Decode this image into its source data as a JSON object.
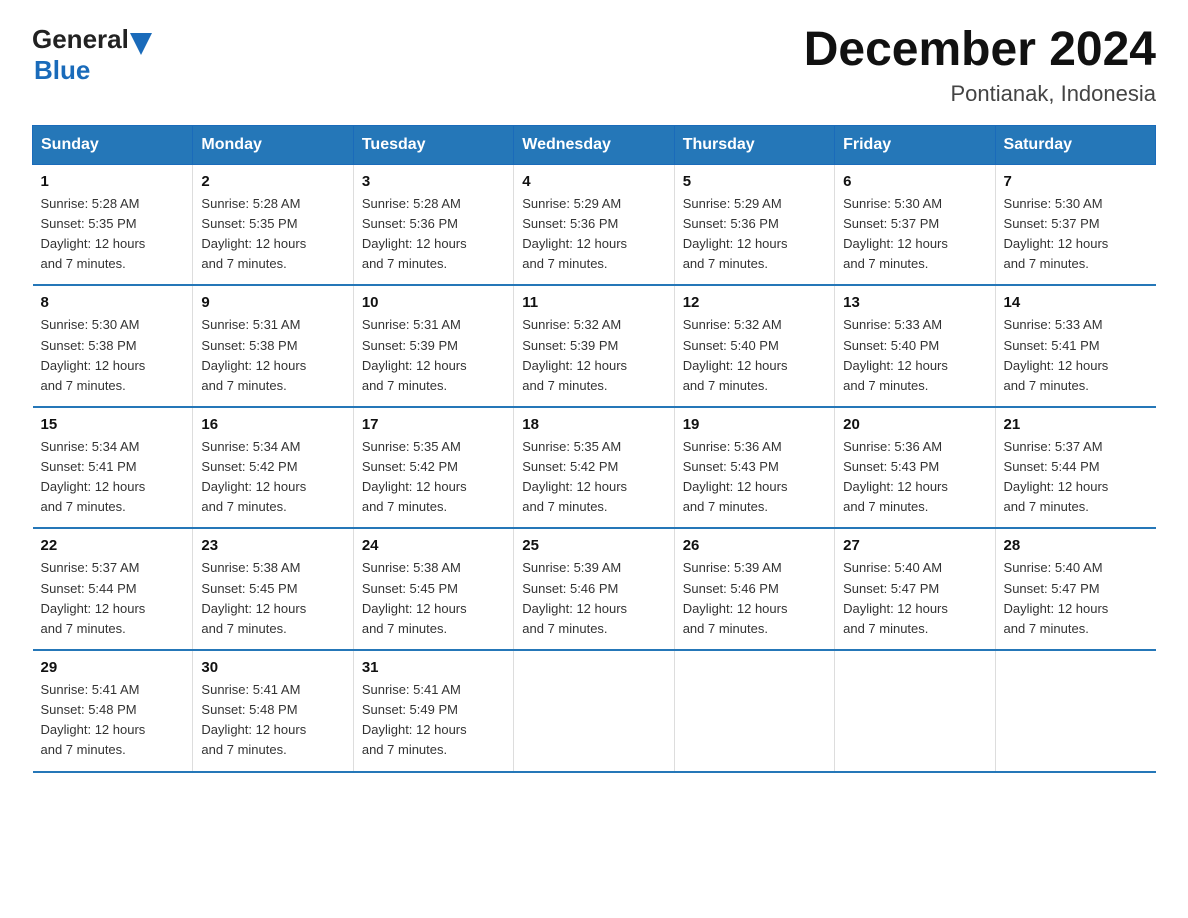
{
  "header": {
    "logo_general": "General",
    "logo_blue": "Blue",
    "month_title": "December 2024",
    "location": "Pontianak, Indonesia"
  },
  "columns": [
    "Sunday",
    "Monday",
    "Tuesday",
    "Wednesday",
    "Thursday",
    "Friday",
    "Saturday"
  ],
  "weeks": [
    [
      {
        "day": "1",
        "sunrise": "5:28 AM",
        "sunset": "5:35 PM",
        "daylight": "12 hours and 7 minutes."
      },
      {
        "day": "2",
        "sunrise": "5:28 AM",
        "sunset": "5:35 PM",
        "daylight": "12 hours and 7 minutes."
      },
      {
        "day": "3",
        "sunrise": "5:28 AM",
        "sunset": "5:36 PM",
        "daylight": "12 hours and 7 minutes."
      },
      {
        "day": "4",
        "sunrise": "5:29 AM",
        "sunset": "5:36 PM",
        "daylight": "12 hours and 7 minutes."
      },
      {
        "day": "5",
        "sunrise": "5:29 AM",
        "sunset": "5:36 PM",
        "daylight": "12 hours and 7 minutes."
      },
      {
        "day": "6",
        "sunrise": "5:30 AM",
        "sunset": "5:37 PM",
        "daylight": "12 hours and 7 minutes."
      },
      {
        "day": "7",
        "sunrise": "5:30 AM",
        "sunset": "5:37 PM",
        "daylight": "12 hours and 7 minutes."
      }
    ],
    [
      {
        "day": "8",
        "sunrise": "5:30 AM",
        "sunset": "5:38 PM",
        "daylight": "12 hours and 7 minutes."
      },
      {
        "day": "9",
        "sunrise": "5:31 AM",
        "sunset": "5:38 PM",
        "daylight": "12 hours and 7 minutes."
      },
      {
        "day": "10",
        "sunrise": "5:31 AM",
        "sunset": "5:39 PM",
        "daylight": "12 hours and 7 minutes."
      },
      {
        "day": "11",
        "sunrise": "5:32 AM",
        "sunset": "5:39 PM",
        "daylight": "12 hours and 7 minutes."
      },
      {
        "day": "12",
        "sunrise": "5:32 AM",
        "sunset": "5:40 PM",
        "daylight": "12 hours and 7 minutes."
      },
      {
        "day": "13",
        "sunrise": "5:33 AM",
        "sunset": "5:40 PM",
        "daylight": "12 hours and 7 minutes."
      },
      {
        "day": "14",
        "sunrise": "5:33 AM",
        "sunset": "5:41 PM",
        "daylight": "12 hours and 7 minutes."
      }
    ],
    [
      {
        "day": "15",
        "sunrise": "5:34 AM",
        "sunset": "5:41 PM",
        "daylight": "12 hours and 7 minutes."
      },
      {
        "day": "16",
        "sunrise": "5:34 AM",
        "sunset": "5:42 PM",
        "daylight": "12 hours and 7 minutes."
      },
      {
        "day": "17",
        "sunrise": "5:35 AM",
        "sunset": "5:42 PM",
        "daylight": "12 hours and 7 minutes."
      },
      {
        "day": "18",
        "sunrise": "5:35 AM",
        "sunset": "5:42 PM",
        "daylight": "12 hours and 7 minutes."
      },
      {
        "day": "19",
        "sunrise": "5:36 AM",
        "sunset": "5:43 PM",
        "daylight": "12 hours and 7 minutes."
      },
      {
        "day": "20",
        "sunrise": "5:36 AM",
        "sunset": "5:43 PM",
        "daylight": "12 hours and 7 minutes."
      },
      {
        "day": "21",
        "sunrise": "5:37 AM",
        "sunset": "5:44 PM",
        "daylight": "12 hours and 7 minutes."
      }
    ],
    [
      {
        "day": "22",
        "sunrise": "5:37 AM",
        "sunset": "5:44 PM",
        "daylight": "12 hours and 7 minutes."
      },
      {
        "day": "23",
        "sunrise": "5:38 AM",
        "sunset": "5:45 PM",
        "daylight": "12 hours and 7 minutes."
      },
      {
        "day": "24",
        "sunrise": "5:38 AM",
        "sunset": "5:45 PM",
        "daylight": "12 hours and 7 minutes."
      },
      {
        "day": "25",
        "sunrise": "5:39 AM",
        "sunset": "5:46 PM",
        "daylight": "12 hours and 7 minutes."
      },
      {
        "day": "26",
        "sunrise": "5:39 AM",
        "sunset": "5:46 PM",
        "daylight": "12 hours and 7 minutes."
      },
      {
        "day": "27",
        "sunrise": "5:40 AM",
        "sunset": "5:47 PM",
        "daylight": "12 hours and 7 minutes."
      },
      {
        "day": "28",
        "sunrise": "5:40 AM",
        "sunset": "5:47 PM",
        "daylight": "12 hours and 7 minutes."
      }
    ],
    [
      {
        "day": "29",
        "sunrise": "5:41 AM",
        "sunset": "5:48 PM",
        "daylight": "12 hours and 7 minutes."
      },
      {
        "day": "30",
        "sunrise": "5:41 AM",
        "sunset": "5:48 PM",
        "daylight": "12 hours and 7 minutes."
      },
      {
        "day": "31",
        "sunrise": "5:41 AM",
        "sunset": "5:49 PM",
        "daylight": "12 hours and 7 minutes."
      },
      null,
      null,
      null,
      null
    ]
  ],
  "labels": {
    "sunrise": "Sunrise:",
    "sunset": "Sunset:",
    "daylight": "Daylight:"
  }
}
